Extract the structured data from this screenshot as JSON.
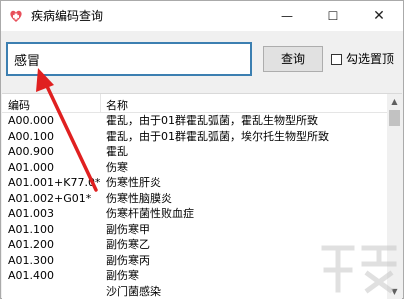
{
  "window": {
    "title": "疾病编码查询"
  },
  "search": {
    "value": "感冒",
    "button_label": "查询",
    "checkbox_label": "勾选置顶"
  },
  "table": {
    "columns": [
      "编码",
      "名称"
    ],
    "rows": [
      {
        "code": "A00.000",
        "name": "霍乱，由于01群霍乱弧菌，霍乱生物型所致"
      },
      {
        "code": "A00.100",
        "name": "霍乱，由于01群霍乱弧菌，埃尔托生物型所致"
      },
      {
        "code": "A00.900",
        "name": "霍乱"
      },
      {
        "code": "A01.000",
        "name": "伤寒"
      },
      {
        "code": "A01.001+K77.0*",
        "name": "伤寒性肝炎"
      },
      {
        "code": "A01.002+G01*",
        "name": "伤寒性脑膜炎"
      },
      {
        "code": "A01.003",
        "name": "伤寒杆菌性败血症"
      },
      {
        "code": "A01.100",
        "name": "副伤寒甲"
      },
      {
        "code": "A01.200",
        "name": "副伤寒乙"
      },
      {
        "code": "A01.300",
        "name": "副伤寒丙"
      },
      {
        "code": "A01.400",
        "name": "副伤寒"
      },
      {
        "code": "",
        "name": "沙门菌感染"
      }
    ]
  },
  "colors": {
    "accent": "#3c7fb1",
    "arrow": "#e02020"
  }
}
